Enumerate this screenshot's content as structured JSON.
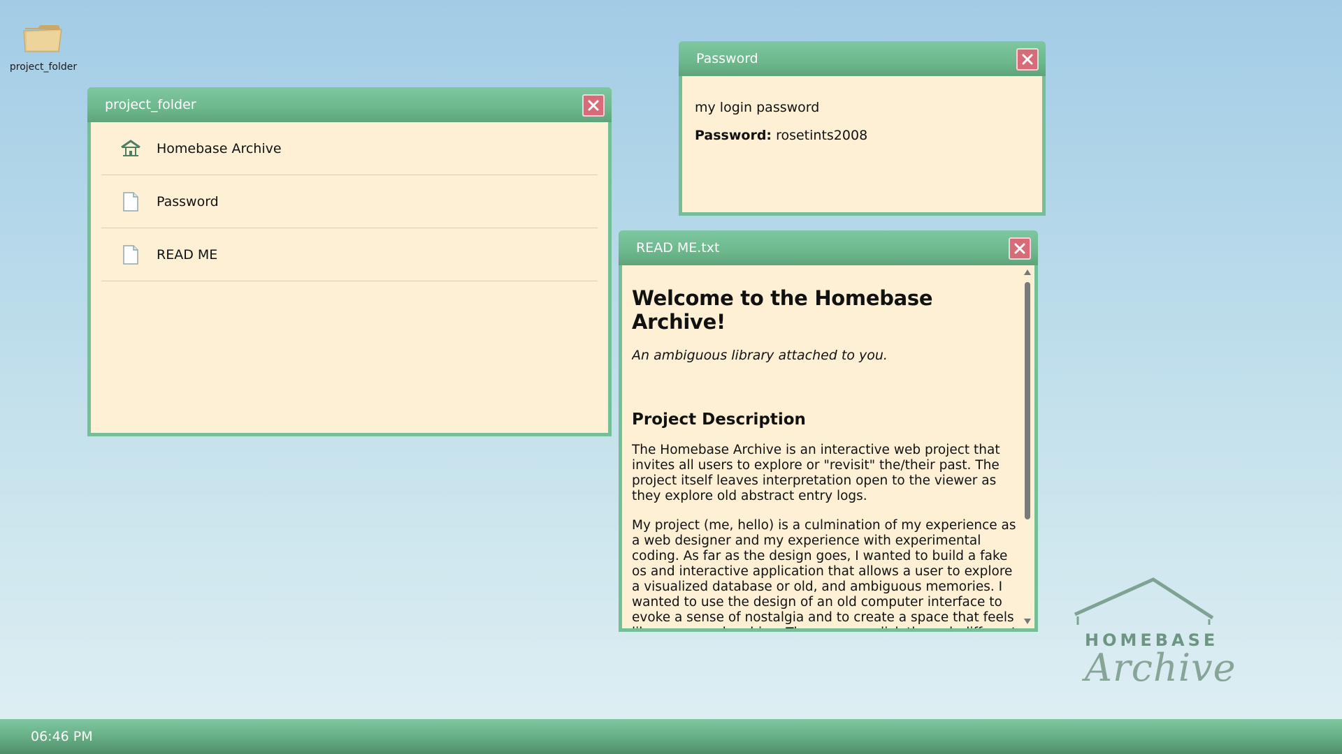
{
  "desktop": {
    "icons": [
      {
        "label": "project_folder",
        "icon": "folder-icon"
      }
    ]
  },
  "windows": {
    "project_folder": {
      "title": "project_folder",
      "items": [
        {
          "label": "Homebase Archive",
          "icon": "house-icon"
        },
        {
          "label": "Password",
          "icon": "document-icon"
        },
        {
          "label": "READ ME",
          "icon": "document-icon"
        }
      ]
    },
    "password": {
      "title": "Password",
      "line1": "my login password",
      "label": "Password:",
      "value": "rosetints2008"
    },
    "readme": {
      "title": "READ ME.txt",
      "heading": "Welcome to the Homebase Archive!",
      "tagline": "An ambiguous library attached to you.",
      "section": "Project Description",
      "para1": "The Homebase Archive is an interactive web project that invites all users to explore or \"revisit\" the/their past. The project itself leaves interpretation open to the viewer as they explore old abstract entry logs.",
      "para2": "My project (me, hello) is a culmination of my experience as a web designer and my experience with experimental coding. As far as the design goes, I wanted to build a fake os and interactive application that allows a user to explore a visualized database or old, and ambiguous memories. I wanted to use the design of an old computer interface to evoke a sense of nostalgia and to create a space that feels like a personal archive. The user can click through different"
    }
  },
  "logo": {
    "line1": "HOMEBASE",
    "line2": "Archive"
  },
  "taskbar": {
    "clock": "06:46 PM"
  },
  "colors": {
    "window_border": "#74bf98",
    "window_body": "#fdf0d5",
    "close_button": "#d86b78",
    "desktop_top": "#a2cce6",
    "desktop_bottom": "#e0f0f3"
  }
}
